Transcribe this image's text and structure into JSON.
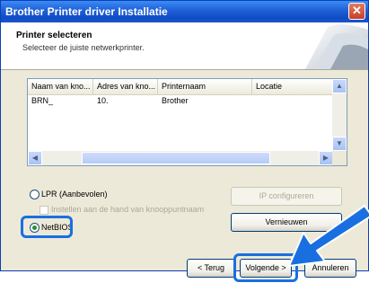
{
  "window": {
    "title": "Brother Printer driver Installatie",
    "close_symbol": "✕"
  },
  "header": {
    "title": "Printer selecteren",
    "subtitle": "Selecteer de juiste netwerkprinter."
  },
  "list": {
    "columns": [
      "Naam van kno...",
      "Adres van kno...",
      "Printernaam",
      "Locatie"
    ],
    "rows": [
      {
        "name": "BRN_",
        "address": "10.",
        "printer": "Brother",
        "location": ""
      }
    ]
  },
  "options": {
    "lpr_label": "LPR (Aanbevolen)",
    "manual_label": "Instellen aan de hand van knooppuntnaam",
    "netbios_label": "NetBIOS",
    "selected": "NetBIOS"
  },
  "buttons": {
    "ip_config": "IP configureren",
    "refresh": "Vernieuwen",
    "back": "< Terug",
    "next": "Volgende >",
    "cancel": "Annuleren"
  },
  "colors": {
    "highlight": "#1a6fe0",
    "titlebar": "#0f4cc4"
  }
}
